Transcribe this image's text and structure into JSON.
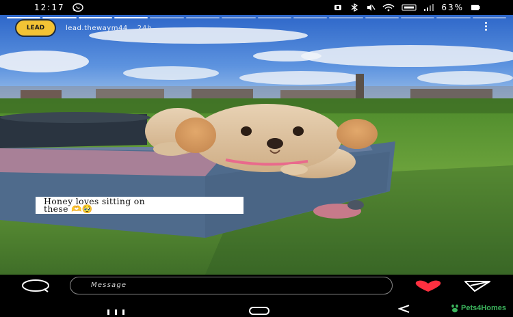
{
  "status_bar": {
    "time": "12:17",
    "battery_percent": "63%",
    "icons": [
      "whatsapp-icon",
      "alarm-icon",
      "bluetooth-icon",
      "mute-icon",
      "wifi-icon",
      "volte-icon",
      "signal-icon",
      "battery-icon"
    ]
  },
  "story": {
    "progress": {
      "segments_total": 14,
      "segments_done": 4
    },
    "account": {
      "avatar_text": "LEAD",
      "username": "lead.thewaym44",
      "time_ago": "24h"
    },
    "caption": {
      "line1": "Honey loves sitting on",
      "line2": "these 🫶🥹"
    }
  },
  "reply_bar": {
    "message_placeholder": "Message"
  },
  "watermark": {
    "text": "Pets4Homes"
  },
  "colors": {
    "heart": "#ff3040",
    "watermark": "#3bb35c",
    "avatar_bg": "#f3c335"
  }
}
